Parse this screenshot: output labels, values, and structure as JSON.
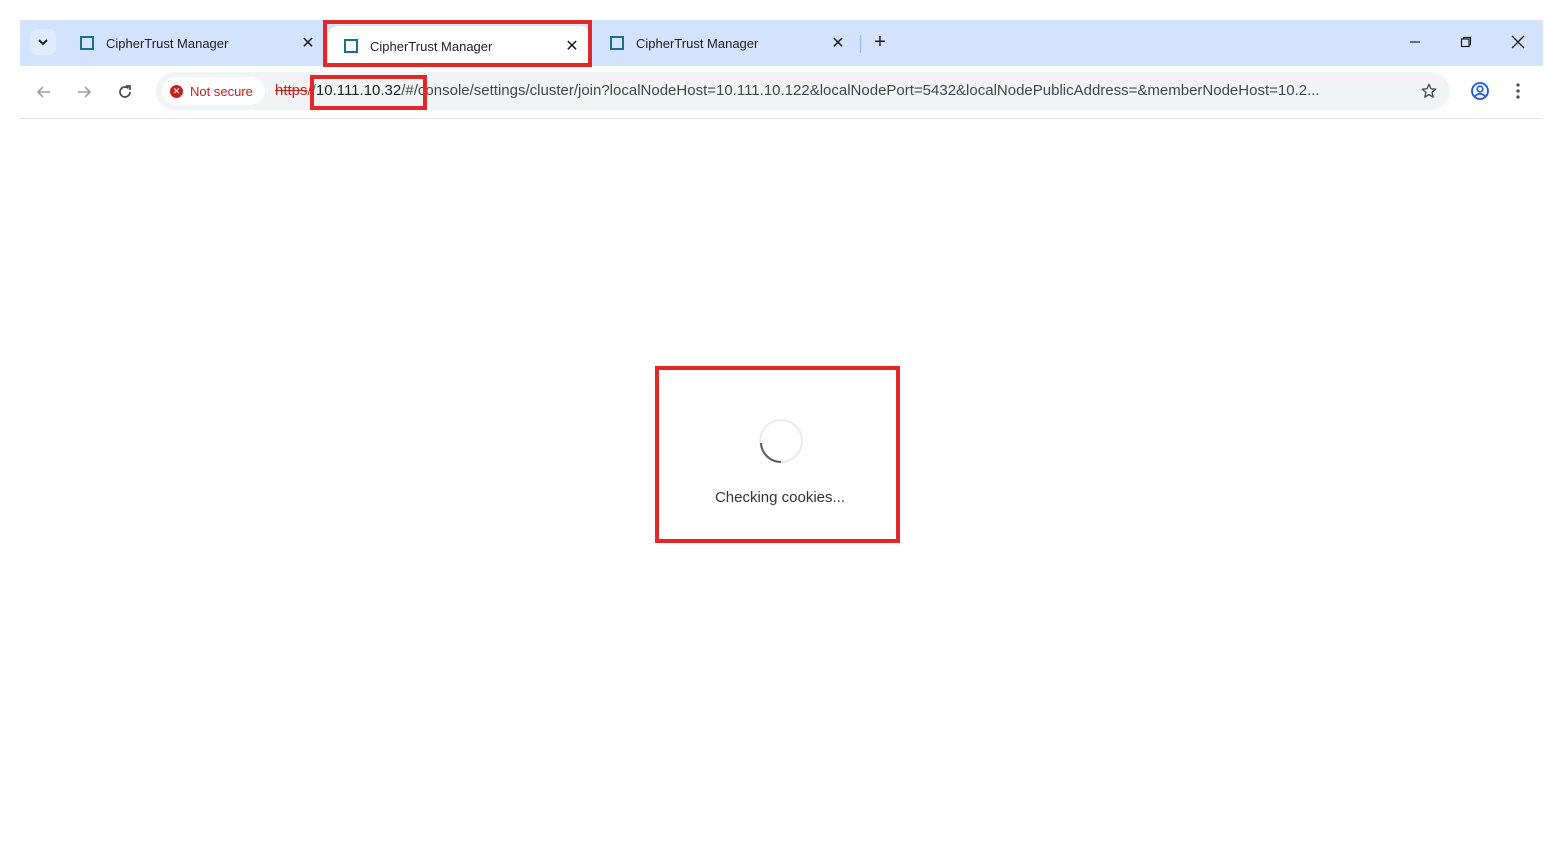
{
  "browser": {
    "tabs": [
      {
        "title": "CipherTrust Manager",
        "active": false
      },
      {
        "title": "CipherTrust Manager",
        "active": true
      },
      {
        "title": "CipherTrust Manager",
        "active": false
      }
    ],
    "security_chip": "Not secure",
    "url": {
      "scheme": "https",
      "separator": "//",
      "host": "10.111.10.32",
      "path": "/#/console/settings/cluster/join?localNodeHost=10.111.10.122&localNodePort=5432&localNodePublicAddress=&memberNodeHost=10.2..."
    }
  },
  "page": {
    "status_text": "Checking cookies..."
  },
  "colors": {
    "highlight": "#e0282b",
    "tabstrip": "#d3e3fd",
    "favicon": "#1a6f8a",
    "not_secure": "#c5221f"
  },
  "icons": [
    "tab-search-icon",
    "favicon-icon",
    "close-icon",
    "plus-icon",
    "minimize-icon",
    "restore-icon",
    "window-close-icon",
    "back-icon",
    "forward-icon",
    "reload-icon",
    "not-secure-icon",
    "star-icon",
    "profile-icon",
    "menu-icon",
    "spinner-icon"
  ]
}
